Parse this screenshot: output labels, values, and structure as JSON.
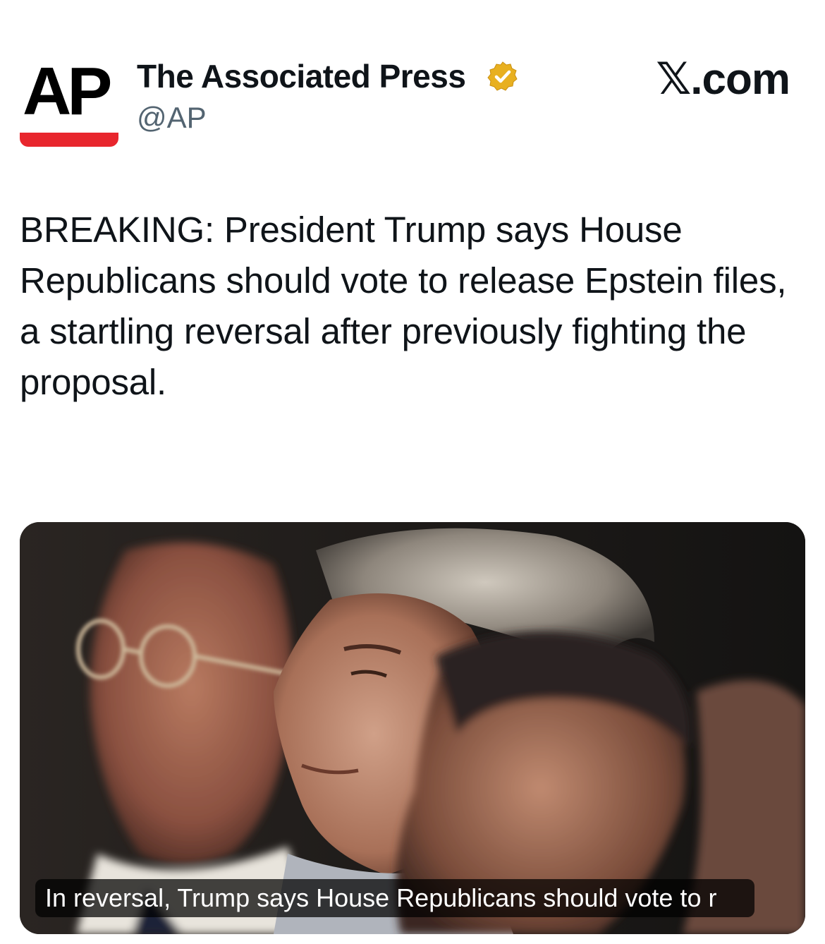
{
  "logo": {
    "text": "AP",
    "bar_color": "#e8262d"
  },
  "account": {
    "name": "The Associated Press",
    "handle": "@AP",
    "verified_icon": "verified-badge-icon",
    "badge_color": "#e8b020"
  },
  "site": {
    "label": "𝕏.com"
  },
  "tweet": {
    "text": "BREAKING: President Trump says House Republicans should vote to release Epstein files, a startling reversal after previously fighting the proposal."
  },
  "media": {
    "caption": "In reversal, Trump says House Republicans should vote to r"
  }
}
